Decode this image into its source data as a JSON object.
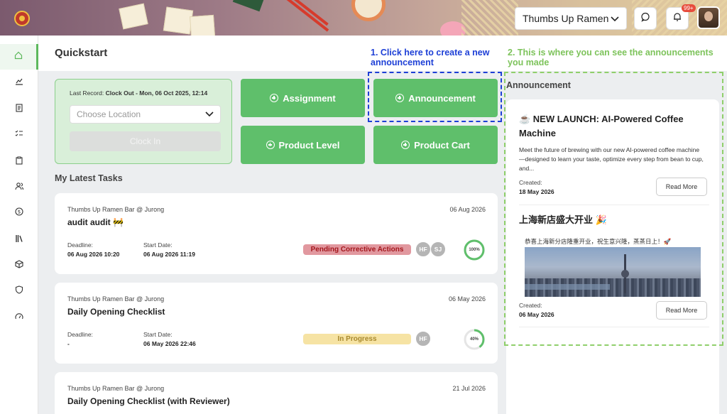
{
  "header": {
    "store_selected": "Thumbs Up Ramen",
    "notification_count": "99+",
    "icons": [
      "chat-icon",
      "bell-icon"
    ]
  },
  "sidebar": {
    "items": [
      {
        "icon": "home-icon",
        "active": true
      },
      {
        "icon": "chart-icon"
      },
      {
        "icon": "document-icon"
      },
      {
        "icon": "checklist-icon"
      },
      {
        "icon": "clipboard-icon"
      },
      {
        "icon": "users-icon"
      },
      {
        "icon": "dollar-icon"
      },
      {
        "icon": "books-icon"
      },
      {
        "icon": "box-icon"
      },
      {
        "icon": "shield-icon"
      },
      {
        "icon": "gauge-icon"
      }
    ]
  },
  "page": {
    "title": "Quickstart"
  },
  "annotations": {
    "create_note": "1. Click here to create a new announcement",
    "view_note": "2. This is where you can see the announcements you made",
    "colors": {
      "blue": "#1d3fd6",
      "green": "#8fcf6b"
    }
  },
  "clock": {
    "last_record_label": "Last Record:",
    "last_record_value": "Clock Out - Mon, 06 Oct 2025, 12:14",
    "location_placeholder": "Choose Location",
    "clock_in_label": "Clock In"
  },
  "quick_actions": {
    "assignment": "Assignment",
    "announcement": "Announcement",
    "product_level": "Product Level",
    "product_cart": "Product Cart",
    "accent": "#5fbf6b"
  },
  "tasks_section": {
    "title": "My Latest Tasks"
  },
  "tasks": [
    {
      "store": "Thumbs Up Ramen Bar @ Jurong",
      "date": "06 Aug 2026",
      "name": "audit audit 🚧",
      "deadline_label": "Deadline:",
      "deadline": "06 Aug 2026 10:20",
      "start_label": "Start Date:",
      "start": "06 Aug 2026 11:19",
      "status": "Pending Corrective Actions",
      "assignees": [
        "HF",
        "SJ"
      ],
      "progress": 100,
      "progress_label": "100%"
    },
    {
      "store": "Thumbs Up Ramen Bar @ Jurong",
      "date": "06 May 2026",
      "name": "Daily Opening Checklist",
      "deadline_label": "Deadline:",
      "deadline": "-",
      "start_label": "Start Date:",
      "start": "06 May 2026 22:46",
      "status": "In Progress",
      "assignees": [
        "HF"
      ],
      "progress": 40,
      "progress_label": "40%"
    },
    {
      "store": "Thumbs Up Ramen Bar @ Jurong",
      "date": "21 Jul 2026",
      "name": "Daily Opening Checklist (with Reviewer)"
    }
  ],
  "announcements": {
    "title": "Announcement",
    "items": [
      {
        "title": "☕ NEW LAUNCH: AI-Powered Coffee Machine",
        "body": "Meet the future of brewing with our new AI-powered coffee machine—designed to learn your taste, optimize every step from bean to cup, and...",
        "created_label": "Created:",
        "created": "18 May 2026",
        "read_more": "Read More"
      },
      {
        "title": "上海新店盛大开业 🎉",
        "body": "恭喜上海新分店隆重开业，祝生意兴隆，蒸蒸日上！🚀",
        "created_label": "Created:",
        "created": "06 May 2026",
        "read_more": "Read More"
      }
    ]
  }
}
